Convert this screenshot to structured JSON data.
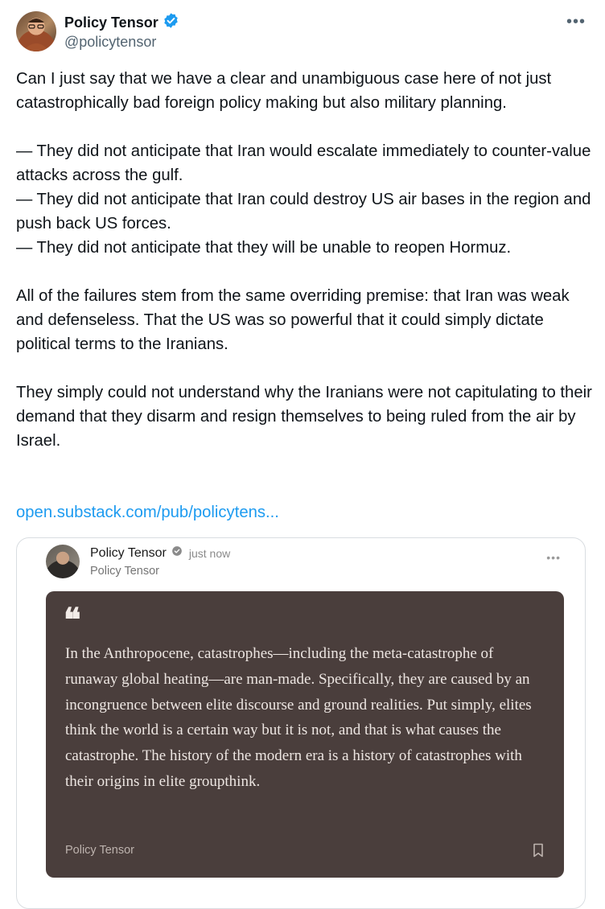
{
  "author": {
    "display_name": "Policy Tensor",
    "handle": "@policytensor",
    "verified": true
  },
  "tweet": {
    "text": "Can I just say that we have a clear and unambiguous case here of not just catastrophically bad foreign policy making but also military planning.\n\n— They did not anticipate that Iran would escalate immediately to counter-value attacks across the gulf.\n— They did not anticipate that Iran could destroy US air bases in the region and push back US forces.\n— They did not anticipate that they will be unable to reopen Hormuz.\n\nAll of the failures stem from the same overriding premise: that Iran was weak and defenseless. That the US was so powerful that it could simply dictate political terms to the Iranians.\n\nThey simply could not understand why the Iranians were not capitulating to their demand that they disarm and resign themselves to being ruled from the air by Israel.",
    "link_text": "open.substack.com/pub/policytens..."
  },
  "card": {
    "author_name": "Policy Tensor",
    "time": "just now",
    "publication": "Policy Tensor",
    "quote_mark": "❝",
    "quote_text": "In the Anthropocene, catastrophes—including the meta-catastrophe of runaway global heating—are man-made. Specifically, they are caused by an incongruence between elite discourse and ground realities. Put simply, elites think the world is a certain way but it is not, and that is what causes the catastrophe. The history of the modern era is a history of catastrophes with their origins in elite groupthink.",
    "footer_label": "Policy Tensor"
  },
  "icons": {
    "verified": "verified-badge-icon",
    "more": "more-icon",
    "bookmark": "bookmark-icon"
  },
  "colors": {
    "link": "#1d9bf0",
    "verified": "#1d9bf0",
    "quote_bg": "#4a3e3c"
  }
}
